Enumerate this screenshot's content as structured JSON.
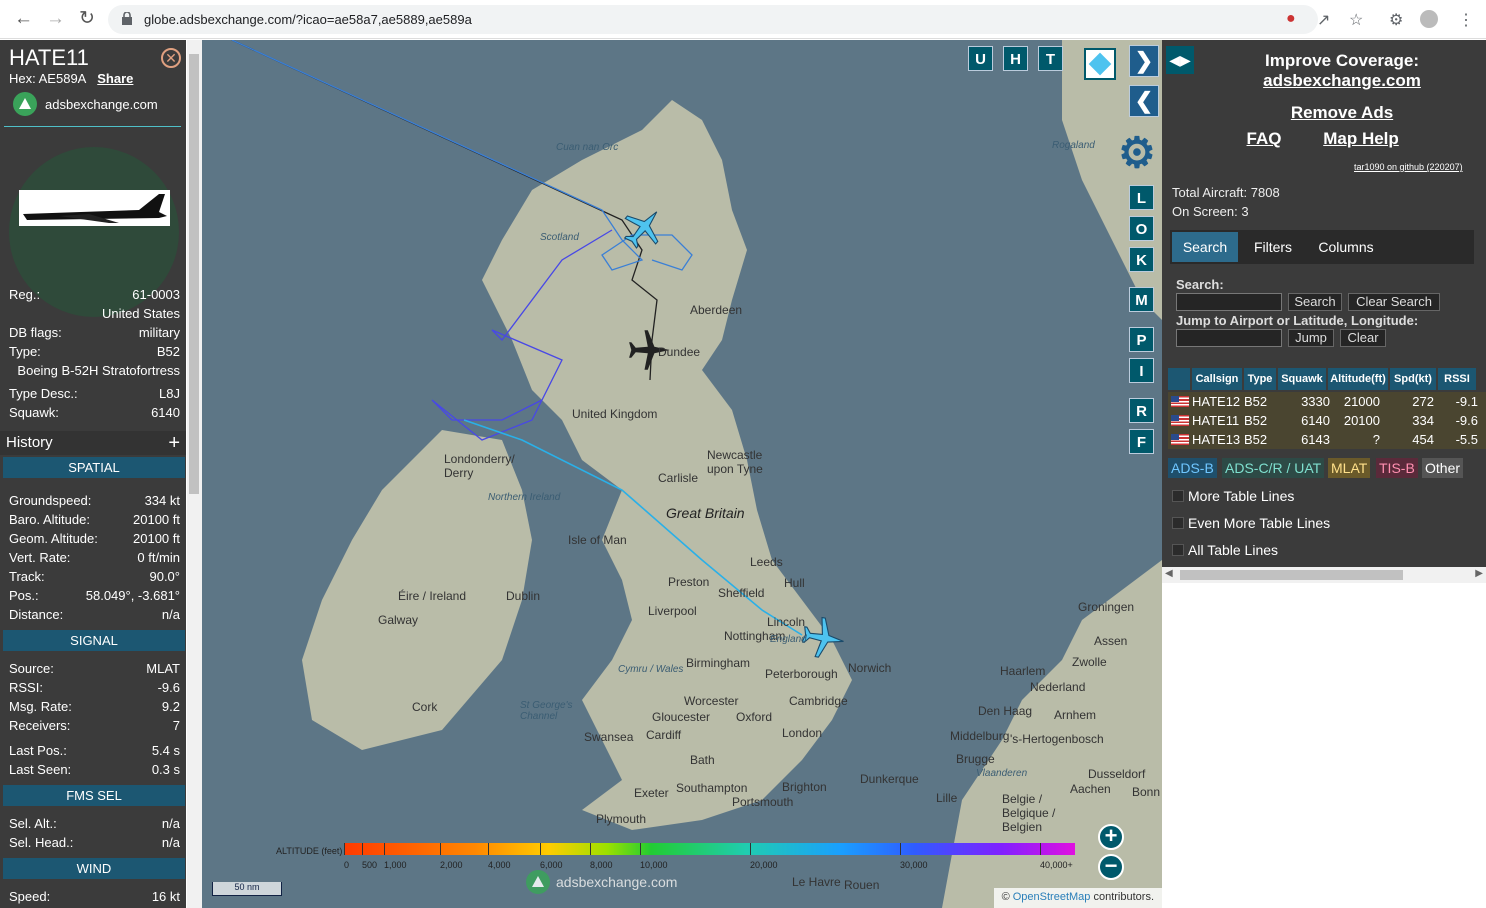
{
  "browser": {
    "url": "globe.adsbexchange.com/?icao=ae58a7,ae5889,ae589a"
  },
  "sidebar": {
    "callsign": "HATE11",
    "hex_label": "Hex:",
    "hex": "AE589A",
    "share": "Share",
    "brand": "adsbexchange.com",
    "fields": [
      {
        "label": "Reg.:",
        "value": "61-0003"
      },
      {
        "label": "",
        "value": "United States"
      },
      {
        "label": "DB flags:",
        "value": "military"
      },
      {
        "label": "Type:",
        "value": "B52"
      },
      {
        "label": "",
        "value": "Boeing B-52H Stratofortress"
      },
      {
        "label": "Type Desc.:",
        "value": "L8J"
      },
      {
        "label": "Squawk:",
        "value": "6140"
      }
    ],
    "history": "History",
    "spatial_header": "SPATIAL",
    "spatial": [
      {
        "label": "Groundspeed:",
        "value": "334 kt"
      },
      {
        "label": "Baro. Altitude:",
        "value": "20100 ft"
      },
      {
        "label": "Geom. Altitude:",
        "value": "20100 ft"
      },
      {
        "label": "Vert. Rate:",
        "value": "0 ft/min"
      },
      {
        "label": "Track:",
        "value": "90.0°"
      },
      {
        "label": "Pos.:",
        "value": "58.049°, -3.681°"
      },
      {
        "label": "Distance:",
        "value": "n/a"
      }
    ],
    "signal_header": "SIGNAL",
    "signal": [
      {
        "label": "Source:",
        "value": "MLAT"
      },
      {
        "label": "RSSI:",
        "value": "-9.6"
      },
      {
        "label": "Msg. Rate:",
        "value": "9.2"
      },
      {
        "label": "Receivers:",
        "value": "7"
      },
      {
        "label": "Last Pos.:",
        "value": "5.4 s"
      },
      {
        "label": "Last Seen:",
        "value": "0.3 s"
      }
    ],
    "fms_header": "FMS SEL",
    "fms": [
      {
        "label": "Sel. Alt.:",
        "value": "n/a"
      },
      {
        "label": "Sel. Head.:",
        "value": "n/a"
      }
    ],
    "wind_header": "WIND",
    "wind": [
      {
        "label": "Speed:",
        "value": "16 kt"
      }
    ]
  },
  "map": {
    "buttons_top": [
      "U",
      "H",
      "T"
    ],
    "buttons_side": [
      "L",
      "O",
      "K",
      "M",
      "P",
      "I",
      "R",
      "F"
    ],
    "places": [
      {
        "name": "Cuan nan Orc",
        "cls": "sea"
      },
      {
        "name": "Scotland",
        "cls": "sea"
      },
      {
        "name": "Aberdeen",
        "cls": ""
      },
      {
        "name": "Dundee",
        "cls": ""
      },
      {
        "name": "United Kingdom",
        "cls": ""
      },
      {
        "name": "Londonderry/ Derry",
        "cls": ""
      },
      {
        "name": "Northern Ireland",
        "cls": "sea"
      },
      {
        "name": "Newcastle upon Tyne",
        "cls": ""
      },
      {
        "name": "Carlisle",
        "cls": ""
      },
      {
        "name": "Great Britain",
        "cls": "big"
      },
      {
        "name": "Isle of Man",
        "cls": ""
      },
      {
        "name": "Leeds",
        "cls": ""
      },
      {
        "name": "Preston",
        "cls": ""
      },
      {
        "name": "Hull",
        "cls": ""
      },
      {
        "name": "Sheffield",
        "cls": ""
      },
      {
        "name": "Éire / Ireland",
        "cls": ""
      },
      {
        "name": "Dublin",
        "cls": ""
      },
      {
        "name": "Galway",
        "cls": ""
      },
      {
        "name": "Liverpool",
        "cls": ""
      },
      {
        "name": "Lincoln",
        "cls": ""
      },
      {
        "name": "Nottingham",
        "cls": ""
      },
      {
        "name": "England",
        "cls": "sea"
      },
      {
        "name": "Birmingham",
        "cls": ""
      },
      {
        "name": "Cymru / Wales",
        "cls": "sea"
      },
      {
        "name": "Peterborough",
        "cls": ""
      },
      {
        "name": "Norwich",
        "cls": ""
      },
      {
        "name": "Cork",
        "cls": ""
      },
      {
        "name": "St George's Channel",
        "cls": "sea"
      },
      {
        "name": "Worcester",
        "cls": ""
      },
      {
        "name": "Cambridge",
        "cls": ""
      },
      {
        "name": "Gloucester",
        "cls": ""
      },
      {
        "name": "Oxford",
        "cls": ""
      },
      {
        "name": "Swansea",
        "cls": ""
      },
      {
        "name": "Cardiff",
        "cls": ""
      },
      {
        "name": "London",
        "cls": ""
      },
      {
        "name": "Bath",
        "cls": ""
      },
      {
        "name": "Exeter",
        "cls": ""
      },
      {
        "name": "Southampton",
        "cls": ""
      },
      {
        "name": "Brighton",
        "cls": ""
      },
      {
        "name": "Portsmouth",
        "cls": ""
      },
      {
        "name": "Plymouth",
        "cls": ""
      },
      {
        "name": "Rogaland",
        "cls": "sea"
      },
      {
        "name": "Groningen",
        "cls": ""
      },
      {
        "name": "Assen",
        "cls": ""
      },
      {
        "name": "Zwolle",
        "cls": ""
      },
      {
        "name": "Haarlem",
        "cls": ""
      },
      {
        "name": "Nederland",
        "cls": ""
      },
      {
        "name": "Den Haag",
        "cls": ""
      },
      {
        "name": "Arnhem",
        "cls": ""
      },
      {
        "name": "Middelburg",
        "cls": ""
      },
      {
        "name": "'s-Hertogenbosch",
        "cls": ""
      },
      {
        "name": "Brugge",
        "cls": ""
      },
      {
        "name": "Dunkerque",
        "cls": ""
      },
      {
        "name": "Vlaanderen",
        "cls": "sea"
      },
      {
        "name": "Dusseldorf",
        "cls": ""
      },
      {
        "name": "Aachen",
        "cls": ""
      },
      {
        "name": "Bonn",
        "cls": ""
      },
      {
        "name": "Lille",
        "cls": ""
      },
      {
        "name": "Belgie / Belgique / Belgien",
        "cls": ""
      },
      {
        "name": "Le Havre",
        "cls": ""
      },
      {
        "name": "Rouen",
        "cls": ""
      }
    ],
    "altitude_title": "ALTITUDE (feet)",
    "altitude_ticks": [
      "0",
      "500",
      "1,000",
      "2,000",
      "4,000",
      "6,000",
      "8,000",
      "10,000",
      "20,000",
      "30,000",
      "40,000+"
    ],
    "scale": "50 nm",
    "watermark": "adsbexchange.com",
    "attribution_prefix": "©",
    "attribution_link": "OpenStreetMap",
    "attribution_suffix": "contributors."
  },
  "right": {
    "improve_title": "Improve Coverage:",
    "improve_link": "adsbexchange.com",
    "remove_ads": "Remove Ads",
    "faq": "FAQ",
    "map_help": "Map Help",
    "version": "tar1090 on github (220207)",
    "total_aircraft": "Total Aircraft: 7808",
    "on_screen": "On Screen: 3",
    "tabs": [
      "Search",
      "Filters",
      "Columns"
    ],
    "search_label": "Search:",
    "search_btn": "Search",
    "clear_search_btn": "Clear Search",
    "jump_label": "Jump to Airport or Latitude, Longitude:",
    "jump_btn": "Jump",
    "clear_btn": "Clear",
    "table": {
      "headers": [
        "Callsign",
        "Type",
        "Squawk",
        "Altitude(ft)",
        "Spd(kt)",
        "RSSI"
      ],
      "rows": [
        {
          "callsign": "HATE12",
          "type": "B52",
          "squawk": "3330",
          "alt": "21000",
          "spd": "272",
          "rssi": "-9.1"
        },
        {
          "callsign": "HATE11",
          "type": "B52",
          "squawk": "6140",
          "alt": "20100",
          "spd": "334",
          "rssi": "-9.6"
        },
        {
          "callsign": "HATE13",
          "type": "B52",
          "squawk": "6143",
          "alt": "?",
          "spd": "454",
          "rssi": "-5.5"
        }
      ]
    },
    "sources": [
      {
        "label": "ADS-B",
        "color": "#1f4f6b",
        "text": "#6fc6ff"
      },
      {
        "label": "ADS-C/R / UAT",
        "color": "#2d4a46",
        "text": "#7fe0cf"
      },
      {
        "label": "MLAT",
        "color": "#6a5a2a",
        "text": "#ffe08a"
      },
      {
        "label": "TIS-B",
        "color": "#5a2a3a",
        "text": "#ff8fb0"
      },
      {
        "label": "Other",
        "color": "#555555",
        "text": "#ffffff"
      }
    ],
    "checkboxes": [
      "More Table Lines",
      "Even More Table Lines",
      "All Table Lines"
    ]
  }
}
